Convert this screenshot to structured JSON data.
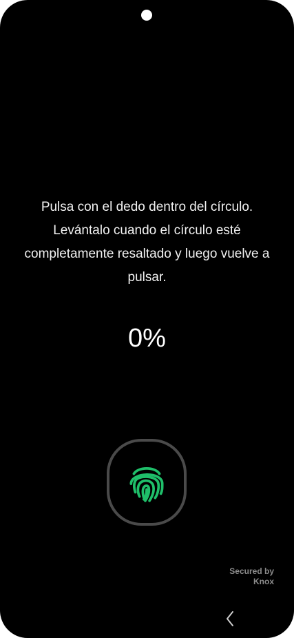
{
  "instruction": {
    "text": "Pulsa con el dedo dentro del círculo. Levántalo cuando el círculo esté completamente resaltado y luego vuelve a pulsar."
  },
  "progress": {
    "label": "0%",
    "value": 0
  },
  "sensor": {
    "icon": "fingerprint-icon",
    "color": "#1fbf6a"
  },
  "knox": {
    "line1": "Secured by",
    "line2": "Knox"
  },
  "navigation": {
    "back_icon": "chevron-left-icon"
  }
}
